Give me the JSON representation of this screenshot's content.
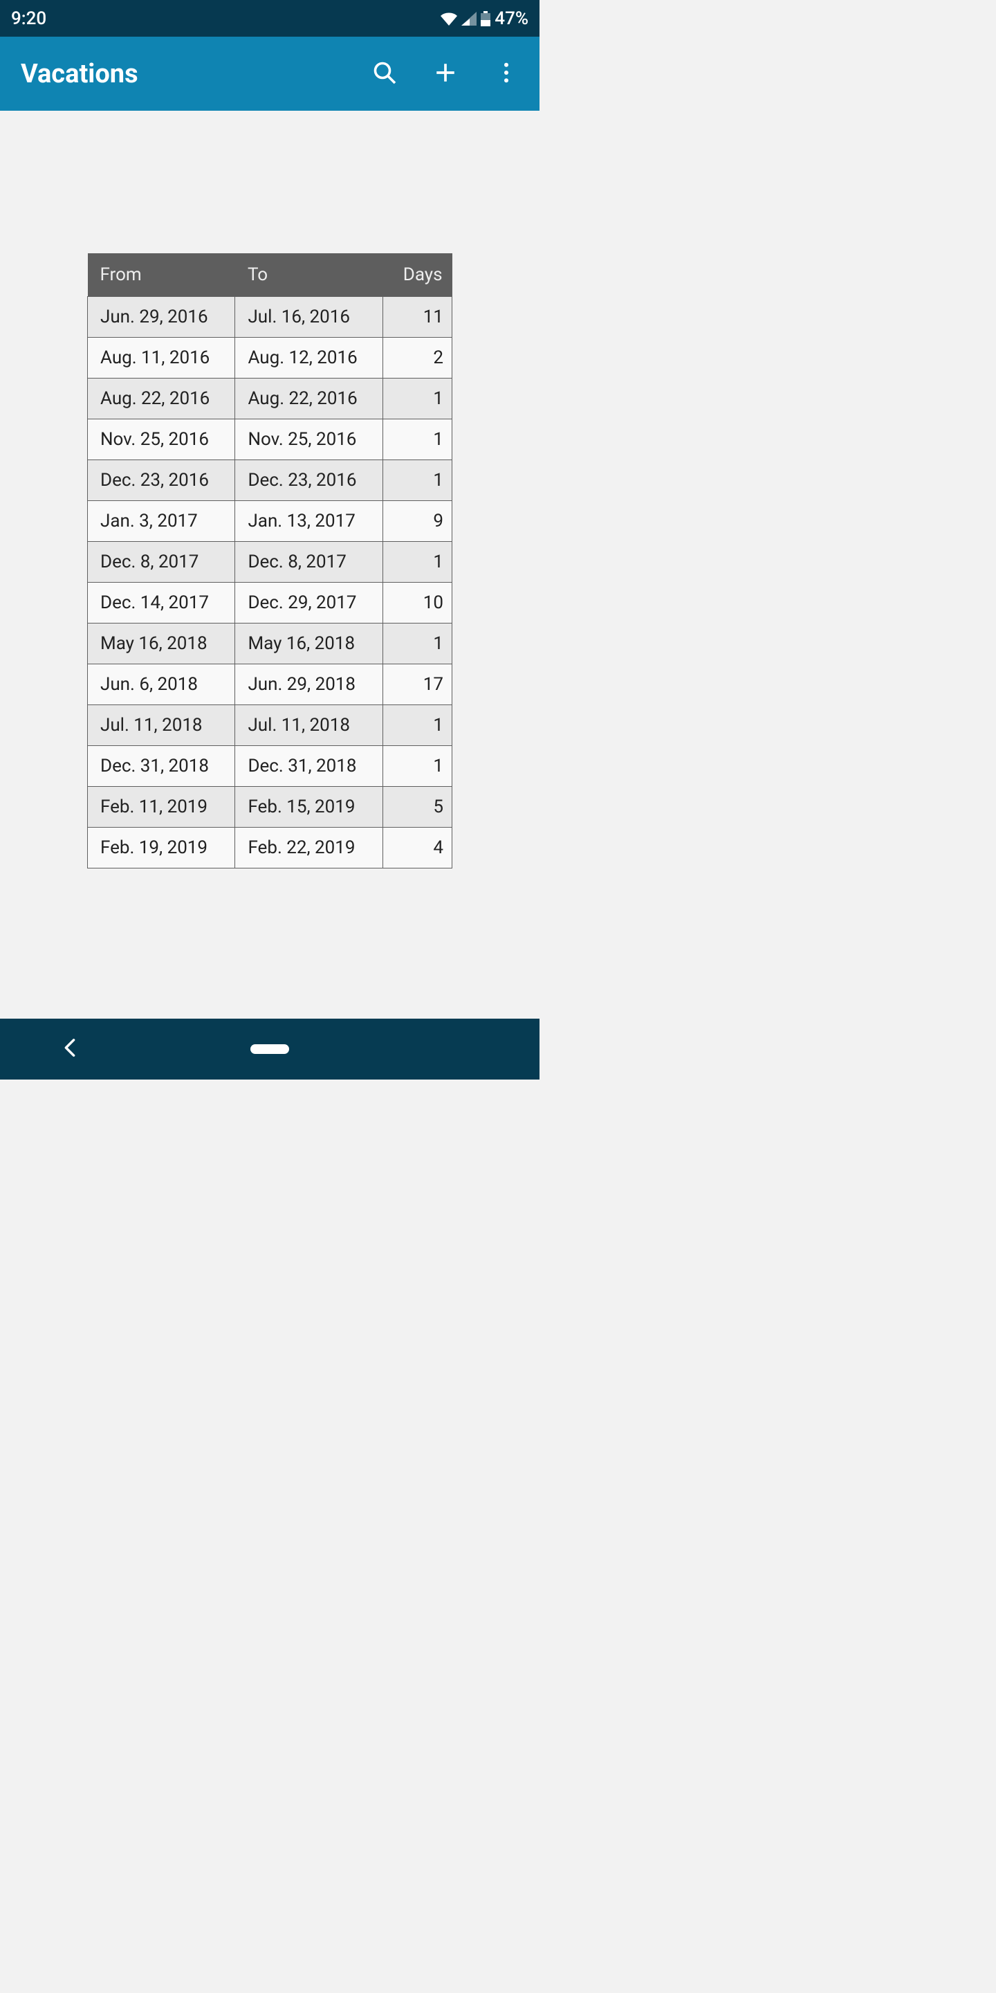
{
  "statusbar": {
    "time": "9:20",
    "battery": "47%"
  },
  "appbar": {
    "title": "Vacations"
  },
  "table": {
    "headers": {
      "from": "From",
      "to": "To",
      "days": "Days"
    },
    "rows": [
      {
        "from": "Jun. 29, 2016",
        "to": "Jul. 16, 2016",
        "days": "11"
      },
      {
        "from": "Aug. 11, 2016",
        "to": "Aug. 12, 2016",
        "days": "2"
      },
      {
        "from": "Aug. 22, 2016",
        "to": "Aug. 22, 2016",
        "days": "1"
      },
      {
        "from": "Nov. 25, 2016",
        "to": "Nov. 25, 2016",
        "days": "1"
      },
      {
        "from": "Dec. 23, 2016",
        "to": "Dec. 23, 2016",
        "days": "1"
      },
      {
        "from": "Jan. 3, 2017",
        "to": "Jan. 13, 2017",
        "days": "9"
      },
      {
        "from": "Dec. 8, 2017",
        "to": "Dec. 8, 2017",
        "days": "1"
      },
      {
        "from": "Dec. 14, 2017",
        "to": "Dec. 29, 2017",
        "days": "10"
      },
      {
        "from": "May 16, 2018",
        "to": "May 16, 2018",
        "days": "1"
      },
      {
        "from": "Jun. 6, 2018",
        "to": "Jun. 29, 2018",
        "days": "17"
      },
      {
        "from": "Jul. 11, 2018",
        "to": "Jul. 11, 2018",
        "days": "1"
      },
      {
        "from": "Dec. 31, 2018",
        "to": "Dec. 31, 2018",
        "days": "1"
      },
      {
        "from": "Feb. 11, 2019",
        "to": "Feb. 15, 2019",
        "days": "5"
      },
      {
        "from": "Feb. 19, 2019",
        "to": "Feb. 22, 2019",
        "days": "4"
      }
    ]
  }
}
